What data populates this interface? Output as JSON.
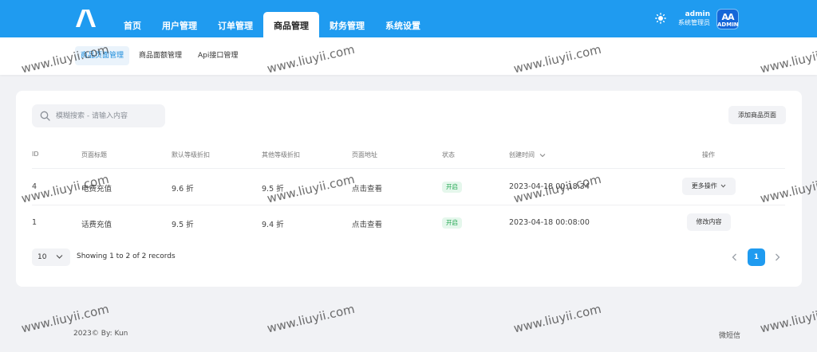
{
  "header": {
    "nav": [
      "首页",
      "用户管理",
      "订单管理",
      "商品管理",
      "财务管理",
      "系统设置"
    ],
    "user_name": "admin",
    "user_role": "系统管理员",
    "avatar_text": "AA",
    "avatar_sub": "ADMIN"
  },
  "subnav": [
    "商品页面管理",
    "商品面额管理",
    "Api接口管理"
  ],
  "toolbar": {
    "search_placeholder": "模糊搜索 - 请输入内容",
    "add_label": "添加商品页面"
  },
  "table": {
    "headers": [
      "ID",
      "页面标题",
      "默认等级折扣",
      "其他等级折扣",
      "页面地址",
      "状态",
      "创建时间",
      "操作"
    ],
    "rows": [
      {
        "id": "4",
        "title": "电费充值",
        "default_discount": "9.6 折",
        "other_discount": "9.5 折",
        "address": "点击查看",
        "status": "开启",
        "created": "2023-04-18 00:18:34",
        "action": "更多操作"
      },
      {
        "id": "1",
        "title": "话费充值",
        "default_discount": "9.5 折",
        "other_discount": "9.4 折",
        "address": "点击查看",
        "status": "开启",
        "created": "2023-04-18 00:08:00",
        "action": "修改内容"
      }
    ]
  },
  "pagination": {
    "page_size": "10",
    "records_text": "Showing 1 to 2 of 2 records",
    "current_page": "1"
  },
  "footer": {
    "left": "2023© By: Kun",
    "right": "微短信"
  },
  "watermark": "www.liuyii.com",
  "colors": {
    "brand": "#1f9bf0",
    "status_green": "#19a34a"
  }
}
